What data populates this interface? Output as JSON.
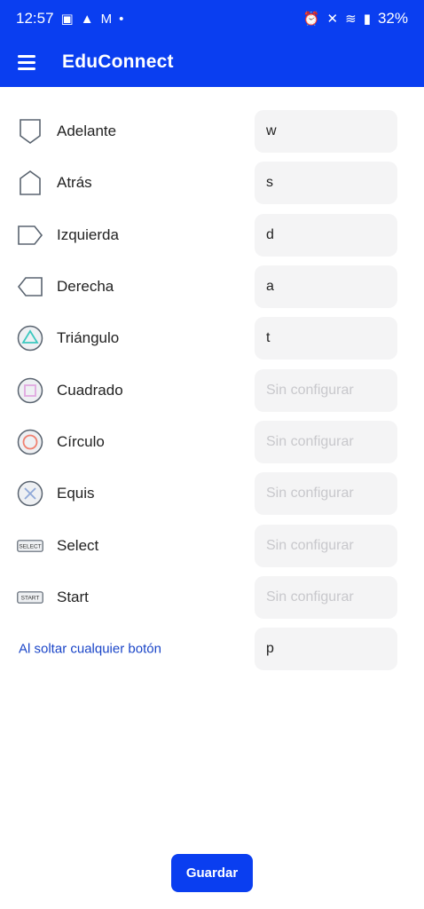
{
  "status_bar": {
    "time": "12:57",
    "battery": "32%",
    "left_icons": [
      "image-icon",
      "navigation-icon",
      "gmail-icon",
      "dot-icon"
    ],
    "right_icons": [
      "alarm-icon",
      "mute-icon",
      "wifi-icon",
      "signal-icon"
    ]
  },
  "header": {
    "title": "EduConnect",
    "menu_icon": "hamburger-icon",
    "background": "#0a3ef0"
  },
  "controls": [
    {
      "label": "Adelante",
      "value": "w",
      "placeholder": "Sin configurar",
      "icon": "dpad-up-icon"
    },
    {
      "label": "Atrás",
      "value": "s",
      "placeholder": "Sin configurar",
      "icon": "dpad-down-icon"
    },
    {
      "label": "Izquierda",
      "value": "d",
      "placeholder": "Sin configurar",
      "icon": "dpad-left-icon"
    },
    {
      "label": "Derecha",
      "value": "a",
      "placeholder": "Sin configurar",
      "icon": "dpad-right-icon"
    },
    {
      "label": "Triángulo",
      "value": "t",
      "placeholder": "Sin configurar",
      "icon": "triangle-button-icon"
    },
    {
      "label": "Cuadrado",
      "value": "",
      "placeholder": "Sin configurar",
      "icon": "square-button-icon"
    },
    {
      "label": "Círculo",
      "value": "",
      "placeholder": "Sin configurar",
      "icon": "circle-button-icon"
    },
    {
      "label": "Equis",
      "value": "",
      "placeholder": "Sin configurar",
      "icon": "cross-button-icon"
    },
    {
      "label": "Select",
      "value": "",
      "placeholder": "Sin configurar",
      "icon": "select-button-icon",
      "icon_text": "SELECT"
    },
    {
      "label": "Start",
      "value": "",
      "placeholder": "Sin configurar",
      "icon": "start-button-icon",
      "icon_text": "START"
    }
  ],
  "release": {
    "label": "Al soltar cualquier botón",
    "value": "p",
    "placeholder": "Sin configurar"
  },
  "save_button": {
    "label": "Guardar"
  },
  "colors": {
    "accent": "#0a3ef0",
    "link": "#1a45c8",
    "field_bg": "#f4f4f5",
    "triangle": "#3cc8c0",
    "square": "#e0a8e0",
    "circle": "#f08070",
    "cross": "#8fa8d8"
  }
}
